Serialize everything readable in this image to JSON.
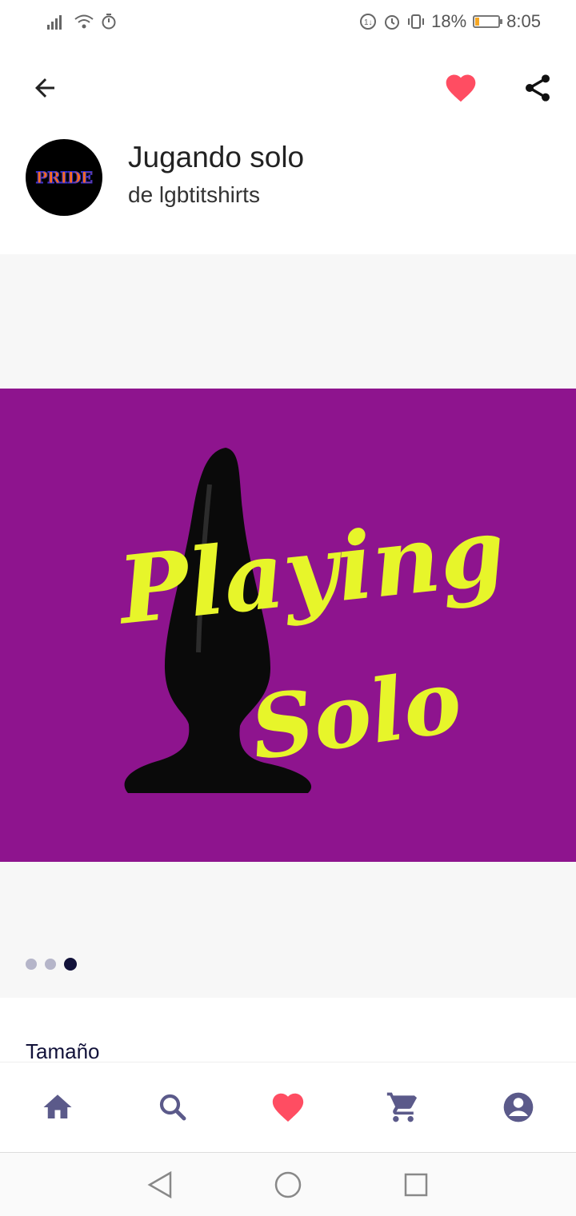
{
  "status_bar": {
    "battery_percent": "18%",
    "time": "8:05",
    "battery_level": 0.18
  },
  "product": {
    "title": "Jugando solo",
    "byline": "de lgbtitshirts",
    "avatar_text": "PRIDE",
    "artwork_text_1": "Playing",
    "artwork_text_2": "Solo"
  },
  "gallery": {
    "page_count": 3,
    "active_index": 2
  },
  "sections": {
    "size_label": "Tamaño"
  },
  "colors": {
    "accent_heart": "#ff4d62",
    "nav_icon": "#5b5a8a",
    "artwork_bg": "#8e148e",
    "artwork_text": "#e7f52a"
  },
  "icons": {
    "back": "arrow-left-icon",
    "favorite": "heart-icon",
    "share": "share-icon",
    "nav": [
      "home-icon",
      "search-icon",
      "heart-icon",
      "cart-icon",
      "account-icon"
    ]
  }
}
